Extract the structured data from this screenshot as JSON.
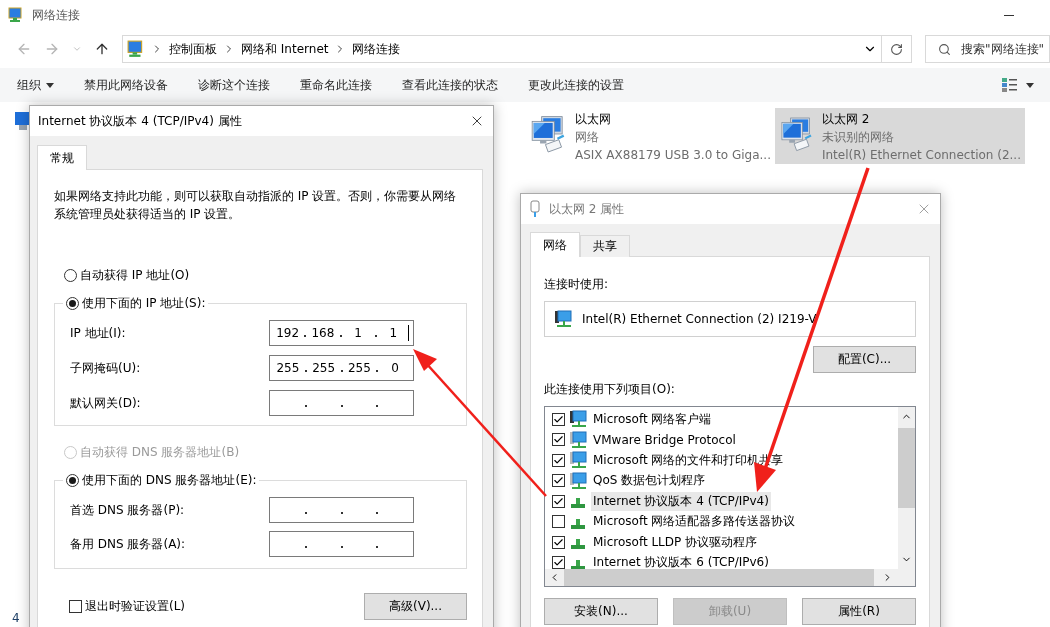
{
  "window": {
    "title": "网络连接"
  },
  "address_bar": {
    "crumbs": [
      "控制面板",
      "网络和 Internet",
      "网络连接"
    ]
  },
  "search": {
    "placeholder": "搜索\"网络连接\""
  },
  "commands": [
    {
      "label": "组织",
      "kind": "menu"
    },
    {
      "label": "禁用此网络设备",
      "kind": "action"
    },
    {
      "label": "诊断这个连接",
      "kind": "action"
    },
    {
      "label": "重命名此连接",
      "kind": "action"
    },
    {
      "label": "查看此连接的状态",
      "kind": "action"
    },
    {
      "label": "更改此连接的设置",
      "kind": "action"
    }
  ],
  "connections": [
    {
      "name": "以太网",
      "status": "网络",
      "device": "ASIX AX88179 USB 3.0 to Giga...",
      "selected": false
    },
    {
      "name": "以太网 2",
      "status": "未识别的网络",
      "device": "Intel(R) Ethernet Connection (2...",
      "selected": true
    }
  ],
  "status_bar": "4",
  "ipv4_dialog": {
    "title": "Internet 协议版本 4 (TCP/IPv4) 属性",
    "tabs": [
      {
        "label": "常规",
        "selected": true
      }
    ],
    "description": "如果网络支持此功能，则可以获取自动指派的 IP 设置。否则，你需要从网络系统管理员处获得适当的 IP 设置。",
    "ip_options": [
      {
        "label": "自动获得 IP 地址(O)",
        "selected": false,
        "disabled": false
      },
      {
        "label": "使用下面的 IP 地址(S):",
        "selected": true,
        "disabled": false
      }
    ],
    "ip_fields": [
      {
        "label": "IP 地址(I):",
        "octets": [
          "192",
          "168",
          "1",
          "1"
        ],
        "focused": true
      },
      {
        "label": "子网掩码(U):",
        "octets": [
          "255",
          "255",
          "255",
          "0"
        ],
        "focused": false
      },
      {
        "label": "默认网关(D):",
        "focused": false
      }
    ],
    "dns_options": [
      {
        "label": "自动获得 DNS 服务器地址(B)",
        "selected": false,
        "disabled": true
      },
      {
        "label": "使用下面的 DNS 服务器地址(E):",
        "selected": true,
        "disabled": false
      }
    ],
    "dns_fields": [
      {
        "label": "首选 DNS 服务器(P):",
        "focused": false
      },
      {
        "label": "备用 DNS 服务器(A):",
        "focused": false
      }
    ],
    "validate": {
      "label": "退出时验证设置(L)",
      "checked": false
    },
    "advanced_button": "高级(V)..."
  },
  "adapter_dialog": {
    "title": "以太网 2 属性",
    "tabs": [
      {
        "label": "网络",
        "selected": true
      },
      {
        "label": "共享",
        "selected": false
      }
    ],
    "connect_using_label": "连接时使用:",
    "adapter": "Intel(R) Ethernet Connection (2) I219-V",
    "configure_button": "配置(C)...",
    "items_label": "此连接使用下列项目(O):",
    "items": [
      {
        "label": "Microsoft 网络客户端",
        "checked": true,
        "selected": false,
        "kind": "client"
      },
      {
        "label": "VMware Bridge Protocol",
        "checked": true,
        "selected": false,
        "kind": "service"
      },
      {
        "label": "Microsoft 网络的文件和打印机共享",
        "checked": true,
        "selected": false,
        "kind": "service"
      },
      {
        "label": "QoS 数据包计划程序",
        "checked": true,
        "selected": false,
        "kind": "service"
      },
      {
        "label": "Internet 协议版本 4 (TCP/IPv4)",
        "checked": true,
        "selected": true,
        "kind": "protocol"
      },
      {
        "label": "Microsoft 网络适配器多路传送器协议",
        "checked": false,
        "selected": false,
        "kind": "protocol"
      },
      {
        "label": "Microsoft LLDP 协议驱动程序",
        "checked": true,
        "selected": false,
        "kind": "protocol"
      },
      {
        "label": "Internet 协议版本 6 (TCP/IPv6)",
        "checked": true,
        "selected": false,
        "kind": "protocol"
      }
    ],
    "buttons": [
      {
        "label": "安装(N)...",
        "disabled": false
      },
      {
        "label": "卸载(U)",
        "disabled": true
      },
      {
        "label": "属性(R)",
        "disabled": false
      }
    ]
  }
}
